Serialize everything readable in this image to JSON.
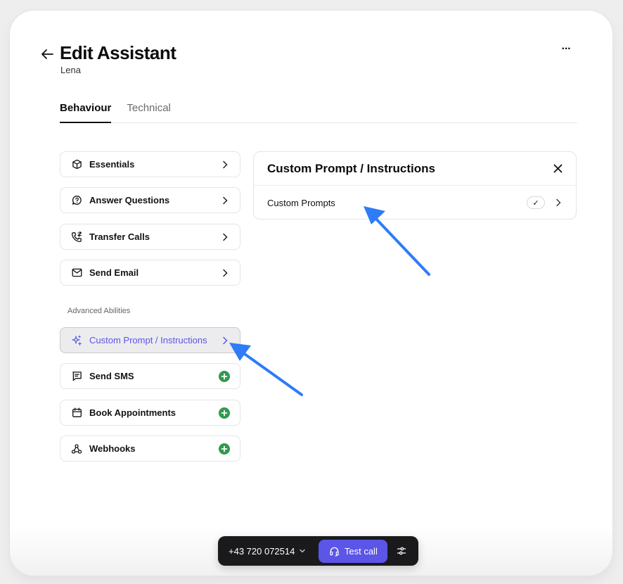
{
  "header": {
    "title": "Edit Assistant",
    "subtitle": "Lena",
    "more_label": "···"
  },
  "tabs": [
    {
      "label": "Behaviour",
      "active": true
    },
    {
      "label": "Technical",
      "active": false
    }
  ],
  "abilities": [
    {
      "label": "Essentials",
      "icon": "box-icon",
      "action": "chevron"
    },
    {
      "label": "Answer Questions",
      "icon": "chat-question-icon",
      "action": "chevron"
    },
    {
      "label": "Transfer Calls",
      "icon": "phone-transfer-icon",
      "action": "chevron"
    },
    {
      "label": "Send Email",
      "icon": "mail-icon",
      "action": "chevron"
    }
  ],
  "advanced": {
    "section_label": "Advanced Abilities",
    "items": [
      {
        "label": "Custom Prompt / Instructions",
        "icon": "sparkle-icon",
        "action": "chevron",
        "selected": true
      },
      {
        "label": "Send SMS",
        "icon": "message-icon",
        "action": "add"
      },
      {
        "label": "Book Appointments",
        "icon": "calendar-icon",
        "action": "add"
      },
      {
        "label": "Webhooks",
        "icon": "webhook-icon",
        "action": "add"
      }
    ]
  },
  "panel": {
    "title": "Custom Prompt / Instructions",
    "rows": [
      {
        "label": "Custom Prompts",
        "status": "✓"
      }
    ]
  },
  "call_bar": {
    "phone_number": "+43 720 072514",
    "test_call_label": "Test call"
  },
  "colors": {
    "accent": "#5b55e8",
    "add_green": "#2f9a4c",
    "annotation_arrow": "#2e7cf6"
  }
}
